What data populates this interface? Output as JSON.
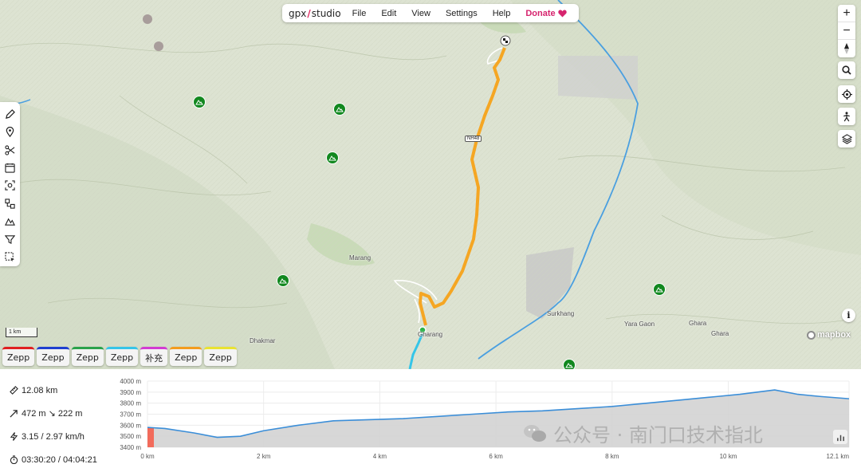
{
  "app": {
    "logo_left": "gpx",
    "logo_right": "studio"
  },
  "menu": {
    "file": "File",
    "edit": "Edit",
    "view": "View",
    "settings": "Settings",
    "help": "Help",
    "donate": "Donate"
  },
  "map": {
    "places": {
      "marang": "Marang",
      "dhakmar": "Dhakmar",
      "gharang": "Gharang",
      "surkhang": "Surkhang",
      "yara_gaon": "Yara Gaon",
      "ghara_1": "Ghara",
      "ghara_2": "Ghara"
    },
    "road_shield": "NH48",
    "scale": "1 km",
    "attribution": "mapbox",
    "info": "i",
    "zoom_in": "+",
    "zoom_out": "−"
  },
  "file_tabs": [
    {
      "label": "Zepp",
      "color": "#e02020"
    },
    {
      "label": "Zepp",
      "color": "#1f3fd0"
    },
    {
      "label": "Zepp",
      "color": "#2aa24a"
    },
    {
      "label": "Zepp",
      "color": "#35c5e8"
    },
    {
      "label": "补充",
      "color": "#d23bd2"
    },
    {
      "label": "Zepp",
      "color": "#f39c1e"
    },
    {
      "label": "Zepp",
      "color": "#e9e332"
    }
  ],
  "stats": {
    "distance": "12.08 km",
    "elevation": "472 m ↘ 222 m",
    "speed": "3.15 / 2.97 km/h",
    "time": "03:30:20 / 04:04:21"
  },
  "watermark": "公众号 · 南门口技术指北",
  "colors": {
    "route": "#f5a623",
    "peak": "#12881f",
    "profile_line": "#3b8ed8",
    "profile_fill": "#d3d3d3",
    "donate": "#d6246e"
  },
  "chart_data": {
    "type": "area",
    "x": [
      0,
      0.3,
      0.8,
      1.2,
      1.6,
      2.0,
      2.6,
      3.2,
      3.8,
      4.4,
      5.0,
      5.6,
      6.2,
      6.8,
      7.4,
      8.0,
      8.6,
      9.2,
      9.8,
      10.2,
      10.5,
      10.8,
      11.2,
      11.6,
      12.08
    ],
    "y": [
      3580,
      3570,
      3530,
      3490,
      3500,
      3550,
      3600,
      3640,
      3650,
      3660,
      3680,
      3700,
      3720,
      3730,
      3750,
      3770,
      3800,
      3830,
      3860,
      3880,
      3900,
      3920,
      3880,
      3860,
      3840
    ],
    "xlabel_unit": "km",
    "x_ticks": [
      "0 km",
      "2 km",
      "4 km",
      "6 km",
      "8 km",
      "10 km",
      "12.1 km"
    ],
    "x_tick_values": [
      0,
      2,
      4,
      6,
      8,
      10,
      12.08
    ],
    "y_ticks": [
      "4000 m",
      "3900 m",
      "3800 m",
      "3700 m",
      "3600 m",
      "3500 m",
      "3400 m"
    ],
    "y_tick_values": [
      4000,
      3900,
      3800,
      3700,
      3600,
      3500,
      3400
    ],
    "xlim": [
      0,
      12.08
    ],
    "ylim": [
      3400,
      4000
    ],
    "grid": true,
    "highlight_range": [
      0,
      0.06
    ]
  }
}
